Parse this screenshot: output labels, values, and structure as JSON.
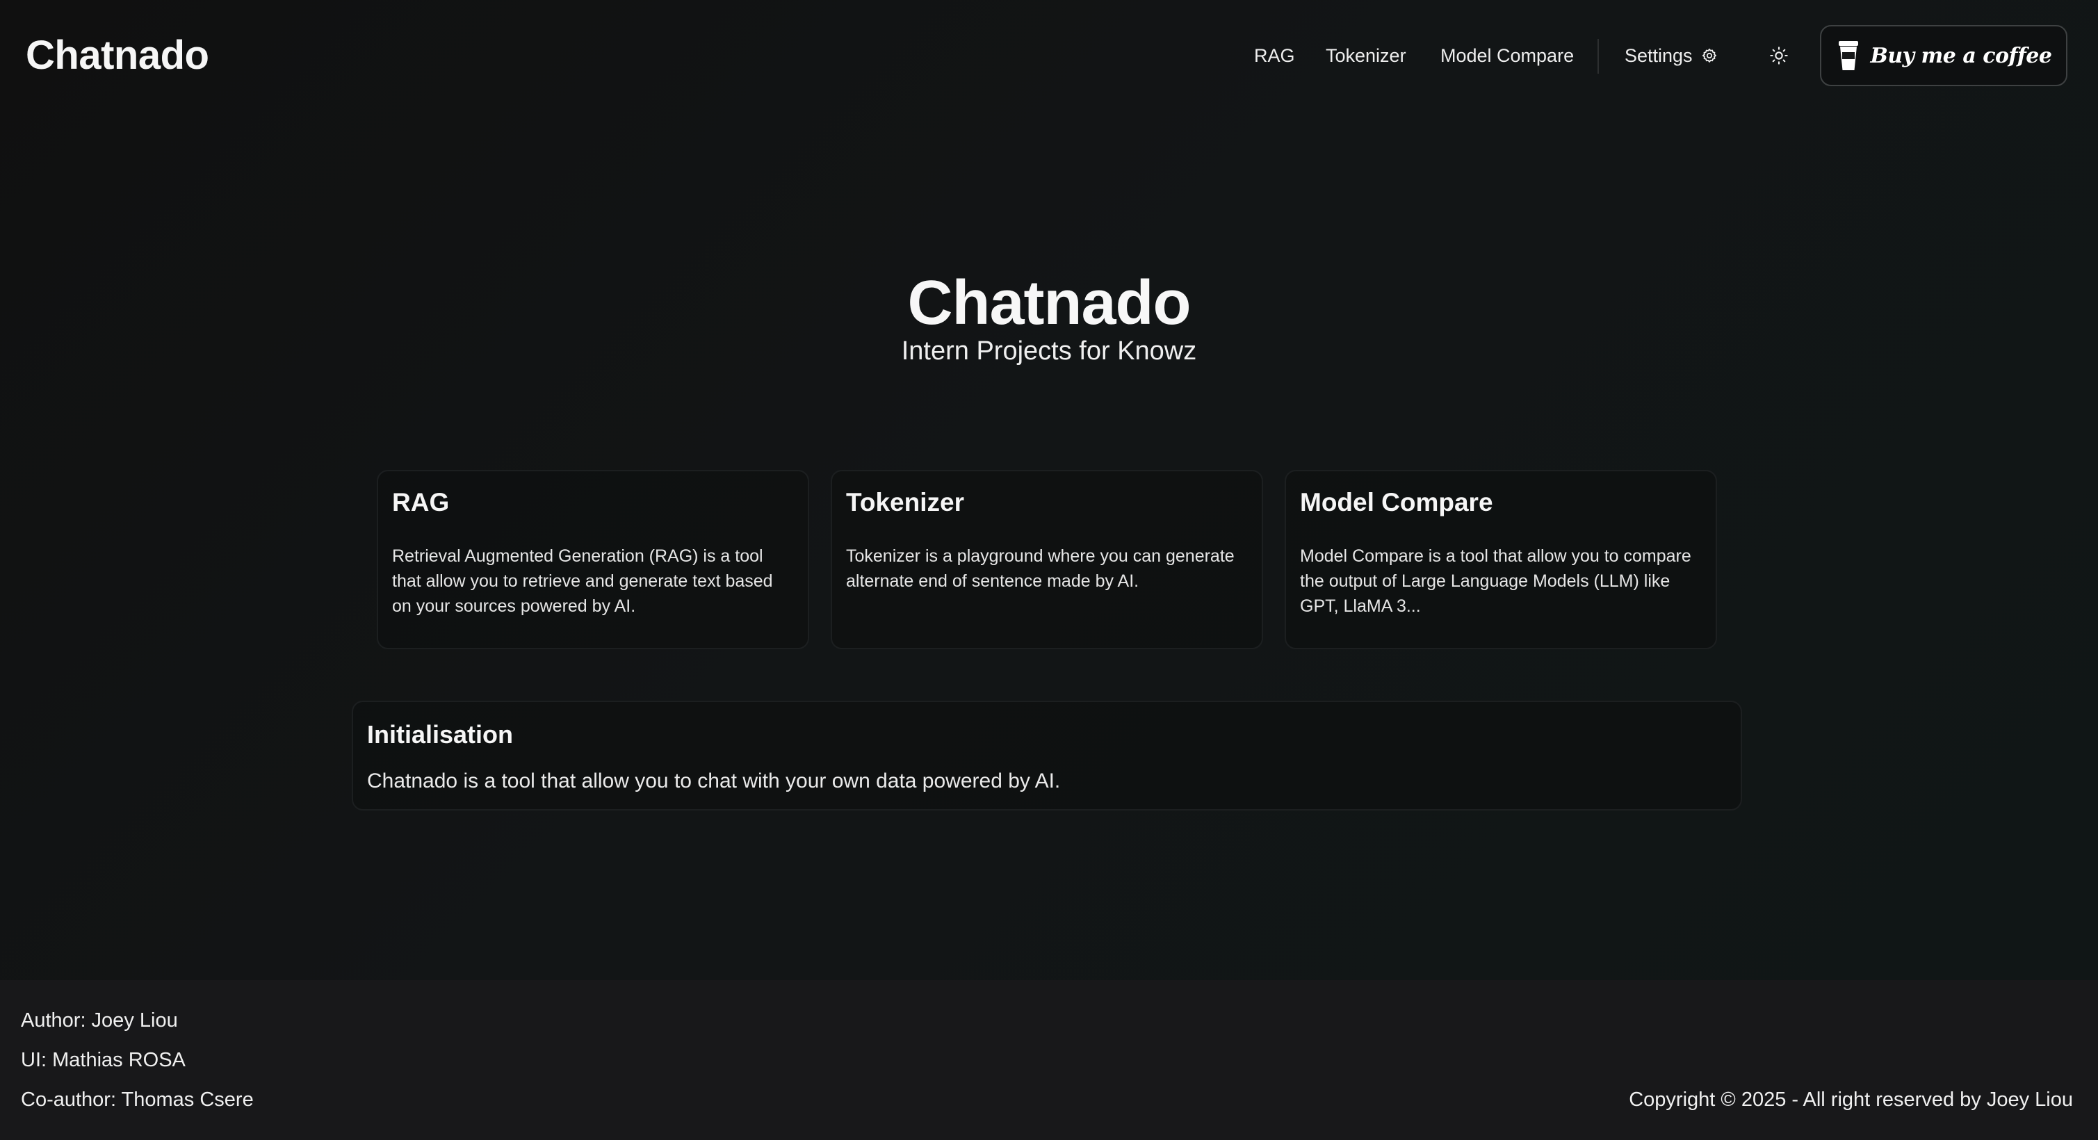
{
  "header": {
    "brand": "Chatnado",
    "nav": [
      {
        "label": "RAG"
      },
      {
        "label": "Tokenizer"
      },
      {
        "label": "Model Compare"
      }
    ],
    "settings_label": "Settings",
    "settings_icon": "gear-icon",
    "theme_icon": "sun-icon",
    "coffee_label": "Buy me a coffee",
    "coffee_icon": "coffee-cup-icon"
  },
  "hero": {
    "title": "Chatnado",
    "subtitle": "Intern Projects for Knowz"
  },
  "cards": [
    {
      "title": "RAG",
      "description": "Retrieval Augmented Generation (RAG) is a tool that allow you to retrieve and generate text based on your sources powered by AI."
    },
    {
      "title": "Tokenizer",
      "description": "Tokenizer is a playground where you can generate alternate end of sentence made by AI."
    },
    {
      "title": "Model Compare",
      "description": "Model Compare is a tool that allow you to compare the output of Large Language Models (LLM) like GPT, LlaMA 3..."
    }
  ],
  "initialisation": {
    "title": "Initialisation",
    "description": "Chatnado is a tool that allow you to chat with your own data powered by AI."
  },
  "footer": {
    "author": "Author: Joey Liou",
    "ui": "UI: Mathias ROSA",
    "coauthor": "Co-author: Thomas Csere",
    "copyright": "Copyright © 2025 - All right reserved by Joey Liou"
  },
  "colors": {
    "background": "#111314",
    "footer_background": "#18181a",
    "text": "#f2f2f2",
    "border": "#1c1f20"
  }
}
